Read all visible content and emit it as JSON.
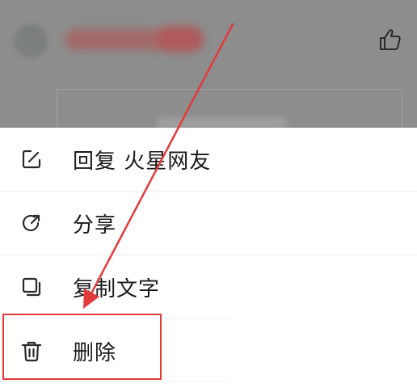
{
  "background": {
    "like_icon": "thumbs-up-icon"
  },
  "menu": {
    "items": [
      {
        "label": "回复 火星网友",
        "icon": "edit-icon"
      },
      {
        "label": "分享",
        "icon": "share-icon"
      },
      {
        "label": "复制文字",
        "icon": "copy-icon"
      },
      {
        "label": "删除",
        "icon": "trash-icon"
      }
    ]
  },
  "annotation": {
    "color": "#e23b3b"
  }
}
